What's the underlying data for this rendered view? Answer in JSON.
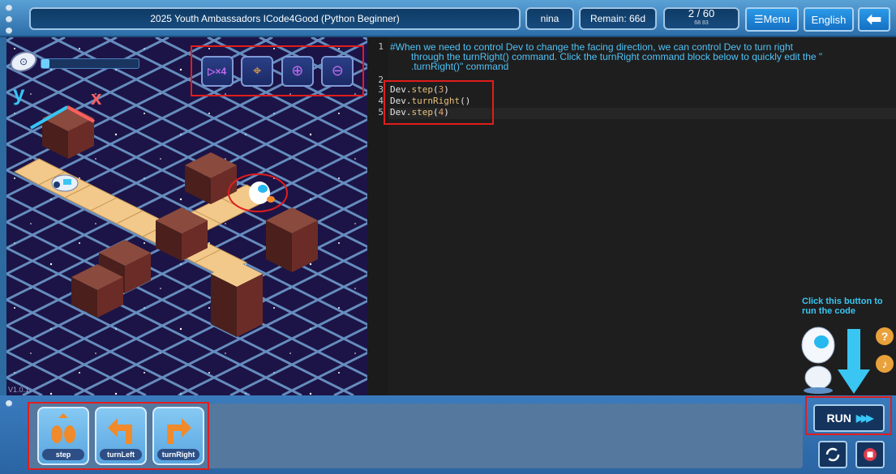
{
  "header": {
    "course_title": "2025 Youth Ambassadors ICode4Good   (Python Beginner)",
    "user": "nina",
    "remaining": "Remain: 66d",
    "level": "2 / 60",
    "level_sub": "68  83",
    "menu_label": "☰Menu",
    "language_label": "English"
  },
  "game": {
    "version": "V1.0.1",
    "progress_fraction": 0.08,
    "tools": [
      {
        "name": "replay-speed-icon",
        "glyph": "▷x4"
      },
      {
        "name": "map-pin-icon",
        "glyph": "📍"
      },
      {
        "name": "zoom-in-icon",
        "glyph": "⊕"
      },
      {
        "name": "zoom-out-icon",
        "glyph": "⊖"
      }
    ],
    "axis_y": "y",
    "axis_x": "x"
  },
  "editor": {
    "comment_line1": "#When we need to control Dev to change the facing direction, we can control Dev to turn right",
    "comment_line2": "through the turnRight() command. Click the turnRight command block below to quickly edit the \"",
    "comment_line3": ".turnRight()\" command",
    "line_numbers": [
      "1",
      "2",
      "3",
      "4",
      "5"
    ],
    "code": [
      {
        "obj": "Dev.",
        "fn": "step",
        "open": "(",
        "arg": "3",
        "close": ")"
      },
      {
        "obj": "Dev.",
        "fn": "turnRight",
        "open": "(",
        "arg": "",
        "close": ")"
      },
      {
        "obj": "Dev.",
        "fn": "step",
        "open": "(",
        "arg": "4",
        "close": ")"
      }
    ],
    "hint": "Click this button to run the code"
  },
  "commands": [
    {
      "label": "step"
    },
    {
      "label": "turnLeft"
    },
    {
      "label": "turnRight"
    }
  ],
  "run_label": "RUN",
  "colors": {
    "accent_red": "#e11d1d",
    "comment": "#4fc3f7",
    "number": "#e6a06d"
  }
}
